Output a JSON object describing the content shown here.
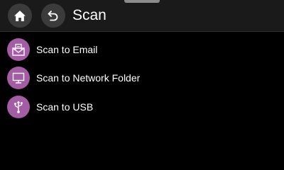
{
  "header": {
    "title": "Scan",
    "home_icon": "home-icon",
    "back_icon": "back-arrow-icon"
  },
  "menu": {
    "items": [
      {
        "label": "Scan to Email",
        "icon": "envelope-icon"
      },
      {
        "label": "Scan to Network Folder",
        "icon": "monitor-icon"
      },
      {
        "label": "Scan to USB",
        "icon": "usb-icon"
      }
    ]
  },
  "colors": {
    "background": "#000000",
    "header_bg": "#1a1a1a",
    "header_button": "#3b3b3b",
    "accent": "#a45da4",
    "text": "#ffffff"
  }
}
